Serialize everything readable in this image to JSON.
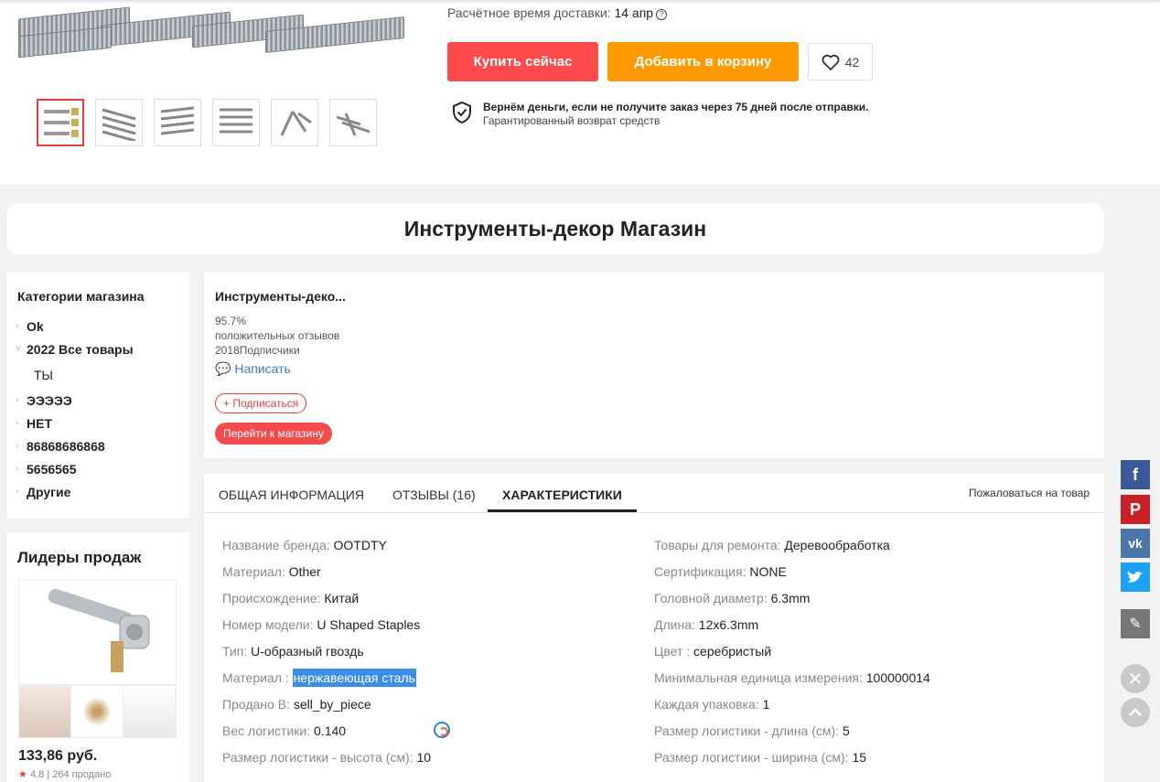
{
  "product": {
    "delivery_label": "Расчётное время доставки:",
    "delivery_date": "14 апр",
    "buy_now": "Купить сейчас",
    "add_to_cart": "Добавить в корзину",
    "wishlist_count": "42",
    "guarantee_title": "Вернём деньги, если не получите заказ через 75 дней после отправки.",
    "guarantee_sub": "Гарантированный возврат средств"
  },
  "store": {
    "banner_title": "Инструменты-декор Магазин"
  },
  "categories": {
    "title": "Категории магазина",
    "items": [
      {
        "label": "Ok",
        "arrow": "›"
      },
      {
        "label": "2022 Все товары",
        "arrow": "˅"
      },
      {
        "label": "ТЫ",
        "arrow": ""
      },
      {
        "label": "ЭЭЭЭЭ",
        "arrow": "›"
      },
      {
        "label": "НЕТ",
        "arrow": "›"
      },
      {
        "label": "86868686868",
        "arrow": "›"
      },
      {
        "label": "5656565",
        "arrow": "›"
      },
      {
        "label": "Другие",
        "arrow": "›"
      }
    ]
  },
  "leaders": {
    "title": "Лидеры продаж",
    "price": "133,86 руб.",
    "rating": "4.8",
    "sold": "264 продано"
  },
  "seller": {
    "name": "Инструменты-деко...",
    "positive_percent": "95.7%",
    "positive_label": "положительных отзывов",
    "followers_count": "2018",
    "followers_label": "Подписчики",
    "write": "Написать",
    "subscribe": "+ Подписаться",
    "go_to_store": "Перейти к магазину"
  },
  "tabs": {
    "general": "ОБЩАЯ ИНФОРМАЦИЯ",
    "reviews": "ОТЗЫВЫ (16)",
    "specs": "ХАРАКТЕРИСТИКИ",
    "report": "Пожаловаться на товар"
  },
  "specs_left": [
    {
      "key": "Название бренда:",
      "value": "OOTDTY"
    },
    {
      "key": "Материал:",
      "value": "Other"
    },
    {
      "key": "Происхождение:",
      "value": "Китай"
    },
    {
      "key": "Номер модели:",
      "value": "U Shaped Staples"
    },
    {
      "key": "Тип:",
      "value": "U-образный гвоздь"
    },
    {
      "key": "Материал :",
      "value": "нержавеющая сталь"
    },
    {
      "key": "Продано В:",
      "value": "sell_by_piece"
    },
    {
      "key": "Вес логистики:",
      "value": "0.140"
    },
    {
      "key": "Размер логистики - высота (см):",
      "value": "10"
    }
  ],
  "specs_right": [
    {
      "key": "Товары для ремонта:",
      "value": "Деревообработка"
    },
    {
      "key": "Сертификация:",
      "value": "NONE"
    },
    {
      "key": "Головной диаметр:",
      "value": "6.3mm"
    },
    {
      "key": "Длина:",
      "value": "12x6.3mm"
    },
    {
      "key": "Цвет :",
      "value": "серебристый"
    },
    {
      "key": "Минимальная единица измерения:",
      "value": "100000014"
    },
    {
      "key": "Каждая упаковка:",
      "value": "1"
    },
    {
      "key": "Размер логистики - длина (см):",
      "value": "5"
    },
    {
      "key": "Размер логистики - ширина (см):",
      "value": "15"
    }
  ],
  "colors": {
    "buy": "#fd4b4b",
    "cart": "#ff9900",
    "facebook": "#3b5998",
    "pinterest": "#cb2027",
    "vk": "#4a76a8",
    "twitter": "#1da1f2"
  }
}
